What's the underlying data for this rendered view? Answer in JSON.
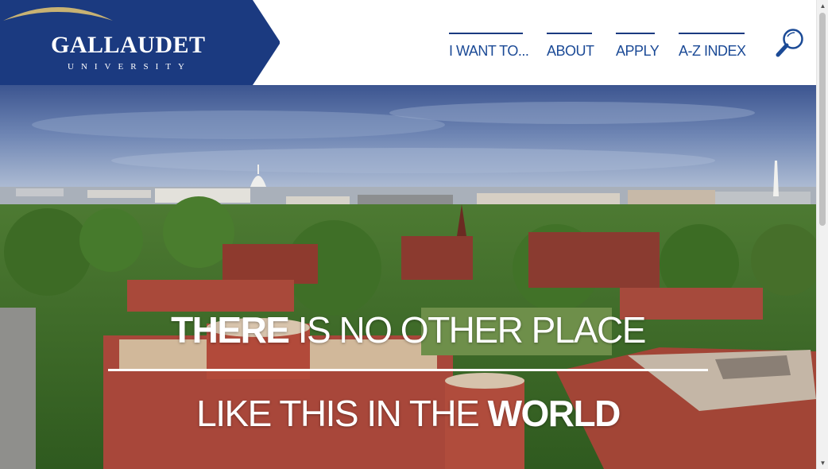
{
  "brand": {
    "name": "GALLAUDET",
    "subtitle": "UNIVERSITY",
    "navy": "#1b3a80",
    "gold": "#c8b273"
  },
  "nav": {
    "items": [
      {
        "label": "I WANT TO..."
      },
      {
        "label": "ABOUT"
      },
      {
        "label": "APPLY"
      },
      {
        "label": "A-Z INDEX"
      }
    ],
    "search_icon": "search-icon",
    "link_color": "#1b4a96"
  },
  "hero": {
    "line1_bold": "THERE",
    "line1_rest": " IS NO OTHER PLACE",
    "line2_rest": "LIKE THIS IN THE ",
    "line2_bold": "WORLD"
  },
  "scrollbar": {
    "up_icon": "scroll-up-arrow-icon",
    "down_icon": "scroll-down-arrow-icon"
  }
}
